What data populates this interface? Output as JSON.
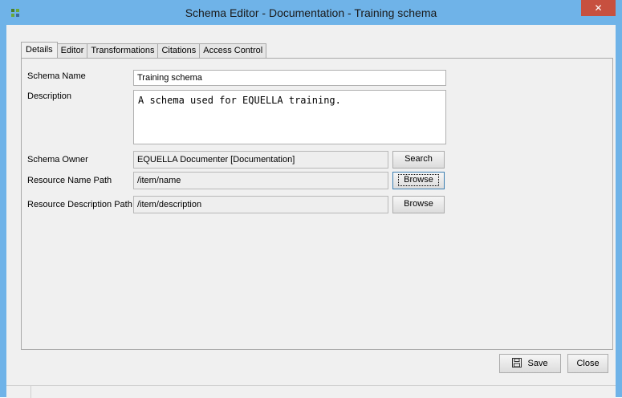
{
  "window": {
    "title": "Schema Editor - Documentation - Training schema",
    "close_glyph": "✕",
    "app_icon": "puzzle-icon"
  },
  "tabs": [
    {
      "label": "Details",
      "active": true
    },
    {
      "label": "Editor",
      "active": false
    },
    {
      "label": "Transformations",
      "active": false
    },
    {
      "label": "Citations",
      "active": false
    },
    {
      "label": "Access Control",
      "active": false
    }
  ],
  "details": {
    "schema_name_label": "Schema Name",
    "schema_name_value": "Training schema",
    "description_label": "Description",
    "description_value": "A schema used for EQUELLA training.",
    "schema_owner_label": "Schema Owner",
    "schema_owner_value": "EQUELLA Documenter [Documentation]",
    "schema_owner_button": "Search",
    "resource_name_path_label": "Resource Name Path",
    "resource_name_path_value": "/item/name",
    "resource_name_path_button": "Browse",
    "resource_description_path_label": "Resource Description Path",
    "resource_description_path_value": "/item/description",
    "resource_description_path_button": "Browse"
  },
  "footer": {
    "save_label": "Save",
    "save_icon": "floppy-disk-icon",
    "close_label": "Close"
  },
  "colors": {
    "titlebar": "#6fb3e8",
    "close_button": "#c7503f",
    "panel": "#f0f0f0"
  }
}
